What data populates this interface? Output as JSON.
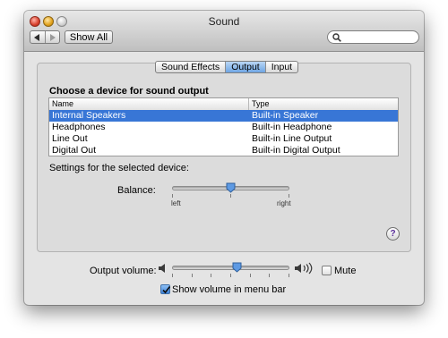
{
  "window": {
    "title": "Sound"
  },
  "toolbar": {
    "back_icon": "left-arrow-icon",
    "forward_icon": "right-arrow-icon",
    "show_all_label": "Show All",
    "search_icon": "magnifier-icon",
    "search_value": ""
  },
  "tabs": [
    {
      "label": "Sound Effects",
      "selected": false
    },
    {
      "label": "Output",
      "selected": true
    },
    {
      "label": "Input",
      "selected": false
    }
  ],
  "output": {
    "heading": "Choose a device for sound output",
    "columns": [
      "Name",
      "Type"
    ],
    "devices": [
      {
        "name": "Internal Speakers",
        "type": "Built-in Speaker",
        "selected": true
      },
      {
        "name": "Headphones",
        "type": "Built-in Headphone",
        "selected": false
      },
      {
        "name": "Line Out",
        "type": "Built-in Line Output",
        "selected": false
      },
      {
        "name": "Digital Out",
        "type": "Built-in Digital Output",
        "selected": false
      }
    ],
    "settings_label": "Settings for the selected device:",
    "balance": {
      "label": "Balance:",
      "left_label": "left",
      "right_label": "right",
      "value": 0.5
    }
  },
  "help_icon": "help-question-icon",
  "help_glyph": "?",
  "volume": {
    "label": "Output volume:",
    "value": 0.55,
    "low_icon": "speaker-low-icon",
    "high_icon": "speaker-high-icon",
    "mute_label": "Mute",
    "mute_checked": false,
    "show_in_menu_label": "Show volume in menu bar",
    "show_in_menu_checked": true
  },
  "colors": {
    "selection": "#3876d6",
    "active_tab": "#6ea5e3",
    "help_accent": "#5a2d9a"
  }
}
